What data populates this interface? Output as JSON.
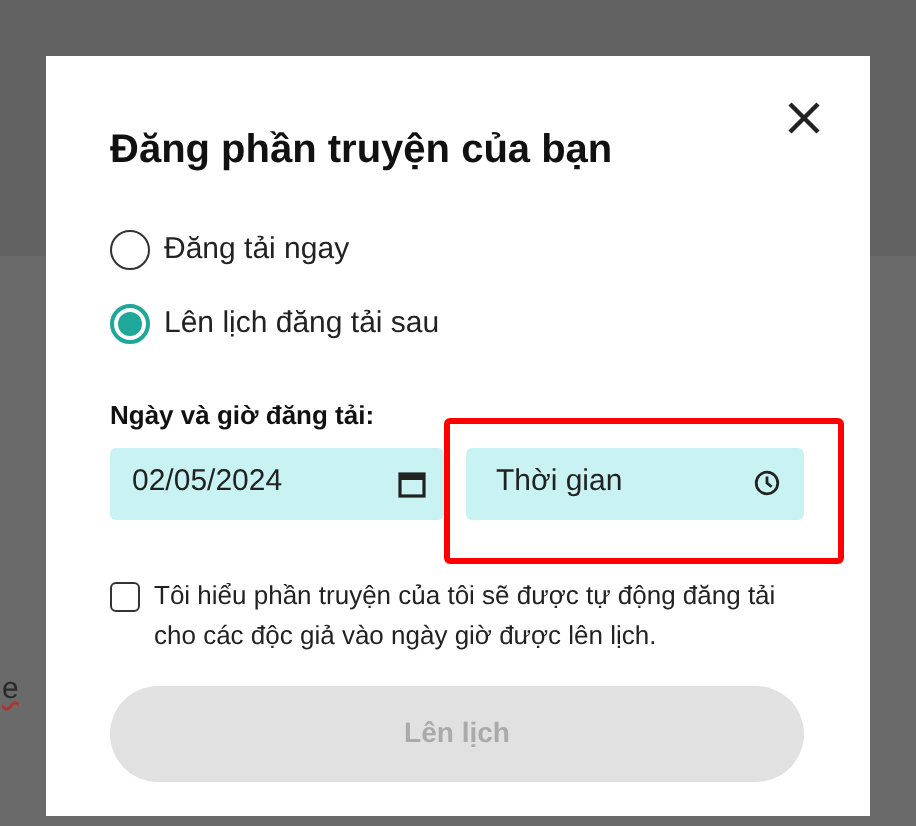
{
  "background": {
    "text": "e"
  },
  "dialog": {
    "title": "Đăng phần truyện của bạn",
    "options": [
      {
        "label": "Đăng tải ngay",
        "selected": false
      },
      {
        "label": "Lên lịch đăng tải sau",
        "selected": true
      }
    ],
    "datetime": {
      "label": "Ngày và giờ đăng tải:",
      "date": "02/05/2024",
      "time_placeholder": "Thời gian",
      "highlighted": true
    },
    "consent": {
      "label": "Tôi hiểu phần truyện của tôi sẽ được tự động đăng tải cho các độc giả vào ngày giờ được lên lịch.",
      "checked": false
    },
    "submit": {
      "label": "Lên lịch",
      "disabled": true
    }
  }
}
